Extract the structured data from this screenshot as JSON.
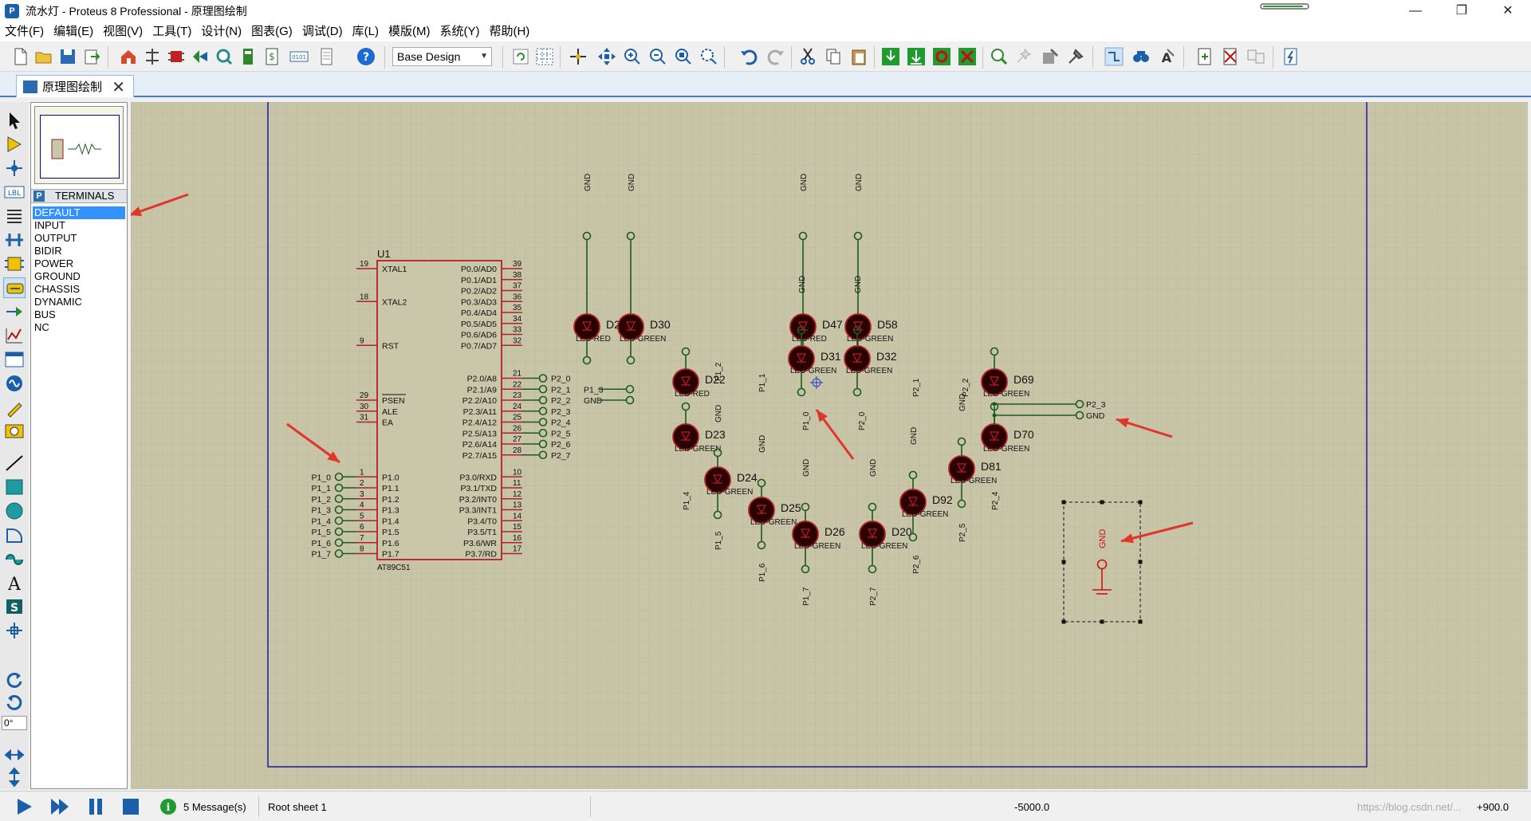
{
  "window": {
    "title": "流水灯 - Proteus 8 Professional - 原理图绘制",
    "minimize": "—",
    "maximize": "❐",
    "close": "✕",
    "progress_fraction": 0.9
  },
  "menu": [
    "文件(F)",
    "编辑(E)",
    "视图(V)",
    "工具(T)",
    "设计(N)",
    "图表(G)",
    "调试(D)",
    "库(L)",
    "模版(M)",
    "系统(Y)",
    "帮助(H)"
  ],
  "toolbar": {
    "design_select": "Base Design"
  },
  "tab": {
    "label": "原理图绘制",
    "close": "✕"
  },
  "left_panel": {
    "mode_badge": "P",
    "header": "TERMINALS",
    "items": [
      "DEFAULT",
      "INPUT",
      "OUTPUT",
      "BIDIR",
      "POWER",
      "GROUND",
      "CHASSIS",
      "DYNAMIC",
      "BUS",
      "NC"
    ],
    "selected_index": 0,
    "rotation": "0°"
  },
  "schematic": {
    "chip": {
      "ref": "U1",
      "part": "AT89C51",
      "left_pins": [
        {
          "num": "19",
          "name": "XTAL1"
        },
        {
          "num": "18",
          "name": "XTAL2"
        },
        {
          "num": "9",
          "name": "RST"
        },
        {
          "num": "29",
          "name": "PSEN"
        },
        {
          "num": "30",
          "name": "ALE"
        },
        {
          "num": "31",
          "name": "EA"
        },
        {
          "num": "1",
          "name": "P1.0"
        },
        {
          "num": "2",
          "name": "P1.1"
        },
        {
          "num": "3",
          "name": "P1.2"
        },
        {
          "num": "4",
          "name": "P1.3"
        },
        {
          "num": "5",
          "name": "P1.4"
        },
        {
          "num": "6",
          "name": "P1.5"
        },
        {
          "num": "7",
          "name": "P1.6"
        },
        {
          "num": "8",
          "name": "P1.7"
        }
      ],
      "right_pins": [
        {
          "num": "39",
          "name": "P0.0/AD0"
        },
        {
          "num": "38",
          "name": "P0.1/AD1"
        },
        {
          "num": "37",
          "name": "P0.2/AD2"
        },
        {
          "num": "36",
          "name": "P0.3/AD3"
        },
        {
          "num": "35",
          "name": "P0.4/AD4"
        },
        {
          "num": "34",
          "name": "P0.5/AD5"
        },
        {
          "num": "33",
          "name": "P0.6/AD6"
        },
        {
          "num": "32",
          "name": "P0.7/AD7"
        },
        {
          "num": "21",
          "name": "P2.0/A8"
        },
        {
          "num": "22",
          "name": "P2.1/A9"
        },
        {
          "num": "23",
          "name": "P2.2/A10"
        },
        {
          "num": "24",
          "name": "P2.3/A11"
        },
        {
          "num": "25",
          "name": "P2.4/A12"
        },
        {
          "num": "26",
          "name": "P2.5/A13"
        },
        {
          "num": "27",
          "name": "P2.6/A14"
        },
        {
          "num": "28",
          "name": "P2.7/A15"
        },
        {
          "num": "10",
          "name": "P3.0/RXD"
        },
        {
          "num": "11",
          "name": "P3.1/TXD"
        },
        {
          "num": "12",
          "name": "P3.2/INT0"
        },
        {
          "num": "13",
          "name": "P3.3/INT1"
        },
        {
          "num": "14",
          "name": "P3.4/T0"
        },
        {
          "num": "15",
          "name": "P3.5/T1"
        },
        {
          "num": "16",
          "name": "P3.6/WR"
        },
        {
          "num": "17",
          "name": "P3.7/RD"
        }
      ]
    },
    "p1_terminals": [
      "P1_0",
      "P1_1",
      "P1_2",
      "P1_3",
      "P1_4",
      "P1_5",
      "P1_6",
      "P1_7"
    ],
    "p2_terminals": [
      "P2_0",
      "P2_1",
      "P2_2",
      "P2_3",
      "P2_4",
      "P2_5",
      "P2_6",
      "P2_7"
    ],
    "extra_terminals": [
      "P1_3",
      "GND",
      "P2_3",
      "GND"
    ],
    "leds": [
      {
        "ref": "D29",
        "part": "LED-RED",
        "net": "GND"
      },
      {
        "ref": "D30",
        "part": "LED-GREEN",
        "net": "GND"
      },
      {
        "ref": "D31",
        "part": "LED-GREEN",
        "net": "GND"
      },
      {
        "ref": "D32",
        "part": "LED-GREEN",
        "net": "GND"
      },
      {
        "ref": "D47",
        "part": "LED-RED",
        "net": "GND"
      },
      {
        "ref": "D58",
        "part": "LED-GREEN",
        "net": "GND"
      },
      {
        "ref": "D22",
        "part": "LED-RED",
        "net": "P1_2"
      },
      {
        "ref": "D69",
        "part": "LED-GREEN",
        "net": "P2_2"
      },
      {
        "ref": "D23",
        "part": "LED-GREEN",
        "net": "P1_4"
      },
      {
        "ref": "D70",
        "part": "LED-GREEN",
        "net": "P2_4"
      },
      {
        "ref": "D24",
        "part": "LED-GREEN",
        "net": "P1_5"
      },
      {
        "ref": "D81",
        "part": "LED-GREEN",
        "net": "P2_5"
      },
      {
        "ref": "D25",
        "part": "LED-GREEN",
        "net": "P1_6"
      },
      {
        "ref": "D92",
        "part": "LED-GREEN",
        "net": "P2_6"
      },
      {
        "ref": "D26",
        "part": "LED-GREEN",
        "net": "P1_7"
      },
      {
        "ref": "D20",
        "part": "LED-GREEN",
        "net": "P2_7"
      }
    ],
    "led_nets": [
      "P1_2",
      "P1_1",
      "P1_0",
      "P2_0",
      "P2_1",
      "P2_2",
      "P1_4",
      "P1_5",
      "P1_6",
      "P1_7",
      "P2_7",
      "P2_6",
      "P2_5",
      "P2_4"
    ],
    "ground_symbol_label": "GND"
  },
  "status": {
    "messages": "5 Message(s)",
    "sheet": "Root sheet 1",
    "x_coord": "-5000.0",
    "y_coord": "+900.0",
    "watermark": "https://blog.csdn.net/..."
  },
  "colors": {
    "sheet_bg": "#c7c4a7",
    "grid": "#b6b399",
    "chip_fill": "#c9c6a9",
    "pin_red": "#b3202a",
    "wire_green": "#1d5a1d",
    "led_body": "#2b0000",
    "arrow_red": "#e0352b",
    "sheet_border": "#1c1ca0"
  }
}
